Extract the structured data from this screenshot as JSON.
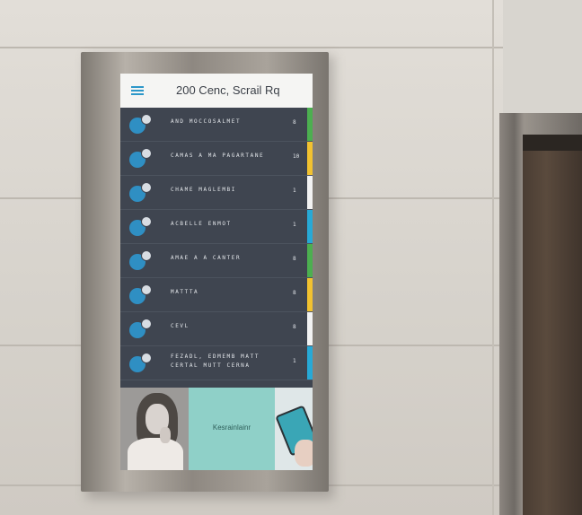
{
  "screen": {
    "header": {
      "title": "200 Cenc, Scrail Rq",
      "menu_icon": "hamburger-menu-icon"
    },
    "rows": [
      {
        "label": "AND MOCCOSALMET",
        "count": "8",
        "stripe_color": "#4caf50",
        "icon": "location-icon"
      },
      {
        "label": "CAMAS A MA PAGARTANE",
        "count": "10",
        "stripe_color": "#f2c230",
        "icon": "location-icon"
      },
      {
        "label": "CHAME MAGLEMBI",
        "count": "1",
        "stripe_color": "#f2f2f2",
        "icon": "location-icon"
      },
      {
        "label": "ACBELLE ENMOT",
        "count": "1",
        "stripe_color": "#27a9d6",
        "icon": "location-icon"
      },
      {
        "label": "AMAE A A CANTER",
        "count": "8",
        "stripe_color": "#4caf50",
        "icon": "location-icon"
      },
      {
        "label": "MATTTA",
        "count": "8",
        "stripe_color": "#f2c230",
        "icon": "location-icon"
      },
      {
        "label": "CEVL",
        "count": "8",
        "stripe_color": "#f2f2f2",
        "icon": "location-icon"
      },
      {
        "label": "FEZADL, EDMEMB MATT CERTAL MUTT CERNA",
        "count": "1",
        "stripe_color": "#27a9d6",
        "icon": "location-icon"
      }
    ],
    "promo": {
      "text": "Kesrainlainr"
    }
  }
}
